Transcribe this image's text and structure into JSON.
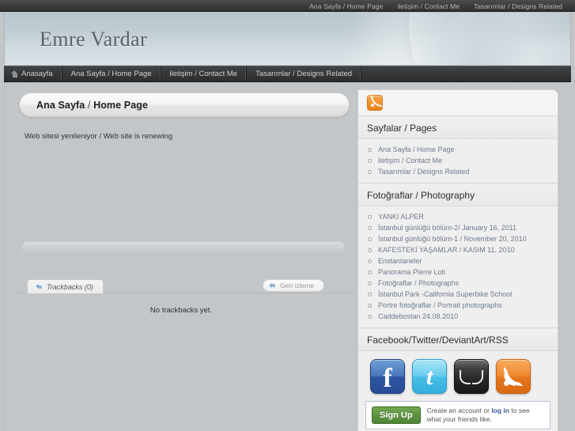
{
  "site": {
    "title": "Emre Vardar"
  },
  "topbar": {
    "links": [
      {
        "label": "Ana Sayfa / Home Page"
      },
      {
        "label": "iletişim / Contact Me"
      },
      {
        "label": "Tasarımlar / Designs Related"
      }
    ]
  },
  "mainnav": {
    "items": [
      {
        "label": "Anasayfa",
        "icon": "home-icon"
      },
      {
        "label": "Ana Sayfa / Home Page",
        "icon": ""
      },
      {
        "label": "iletişim / Contact Me",
        "icon": ""
      },
      {
        "label": "Tasarımlar / Designs Related",
        "icon": ""
      }
    ]
  },
  "post": {
    "title_main": "Ana Sayfa",
    "title_sep": " / ",
    "title_rest": "Home Page",
    "body": "Web sitesi yenileniyor / Web site is renewing"
  },
  "trackbacks": {
    "tab_label": "Trackbacks (0)",
    "back_button_label": "Geri izleme",
    "empty_message": "No trackbacks yet."
  },
  "sidebar": {
    "rss_icon": "rss-icon",
    "sections": [
      {
        "heading": "Sayfalar / Pages",
        "items": [
          {
            "label": "Ana Sayfa / Home Page"
          },
          {
            "label": "iletişim / Contact Me"
          },
          {
            "label": "Tasarımlar / Designs Related"
          }
        ]
      },
      {
        "heading": "Fotoğraflar / Photography",
        "items": [
          {
            "label": "YANKI ALPER"
          },
          {
            "label": "İstanbul günlüğü bölüm-2/ January 16, 2011"
          },
          {
            "label": "İstanbul günlüğü bölüm-1 / November 20, 2010"
          },
          {
            "label": "KAFESTEKİ YAŞAMLAR / KASIM 11, 2010"
          },
          {
            "label": "Enstantaneler"
          },
          {
            "label": "Panorama Pierre Loti"
          },
          {
            "label": "Fotoğraflar / Photographs"
          },
          {
            "label": "İstanbul Park -California Superbike School"
          },
          {
            "label": "Portre fotoğraflar / Portrait photographs"
          },
          {
            "label": "Caddebostan 24.08.2010"
          }
        ]
      }
    ],
    "social": {
      "heading": "Facebook/Twitter/DeviantArt/RSS",
      "icons": [
        {
          "name": "facebook-icon",
          "glyph": "f"
        },
        {
          "name": "twitter-icon",
          "glyph": "t"
        },
        {
          "name": "deviantart-icon",
          "glyph": ""
        },
        {
          "name": "rss-icon",
          "glyph": ""
        }
      ],
      "signup_label": "Sign Up",
      "promo_prefix": "Create an account or ",
      "promo_link": "log in",
      "promo_suffix": " to see what your friends like."
    }
  },
  "colors": {
    "accent_orange": "#e8821a",
    "facebook_blue": "#3b5998",
    "twitter_blue": "#45bde6",
    "signup_green": "#5e9441",
    "link_blue": "#6e7b8c"
  }
}
